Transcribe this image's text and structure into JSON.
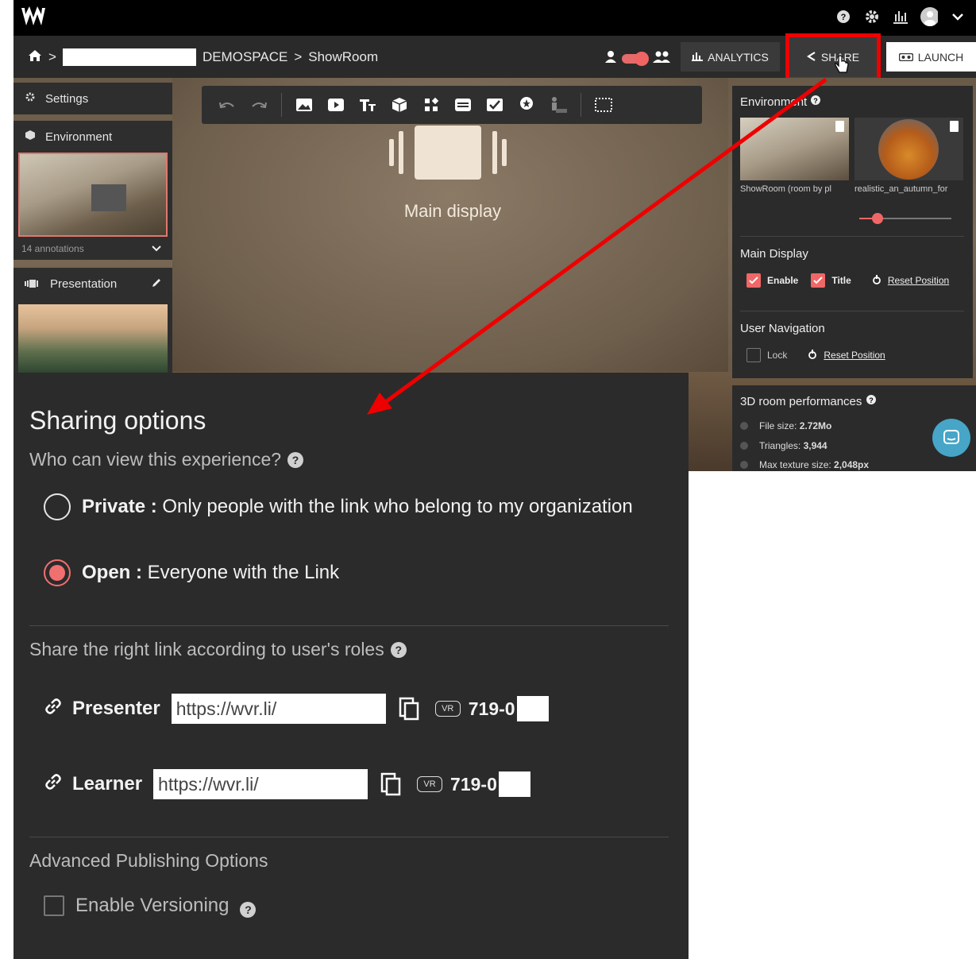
{
  "header": {
    "icons": [
      "help-icon",
      "gear-icon",
      "analytics-icon",
      "avatar",
      "chevron-down-icon"
    ]
  },
  "nav": {
    "breadcrumb": {
      "space": "DEMOSPACE",
      "separator": ">",
      "room": "ShowRoom"
    },
    "analytics_label": "ANALYTICS",
    "share_label": "SHARE",
    "launch_label": "LAUNCH"
  },
  "left_panel": {
    "settings_label": "Settings",
    "environment_label": "Environment",
    "annotations_label": "14 annotations",
    "presentation_label": "Presentation"
  },
  "canvas": {
    "display_label": "Main display"
  },
  "right_panel": {
    "environment_title": "Environment",
    "env_items": [
      {
        "caption": "ShowRoom (room by pl"
      },
      {
        "caption": "realistic_an_autumn_for"
      }
    ],
    "main_display_title": "Main Display",
    "enable_label": "Enable",
    "title_label": "Title",
    "reset_position_label": "Reset Position",
    "user_navigation_title": "User Navigation",
    "lock_label": "Lock"
  },
  "performance": {
    "title": "3D room performances",
    "rows": [
      {
        "label": "File size: ",
        "value": "2.72Mo"
      },
      {
        "label": "Triangles: ",
        "value": "3,944"
      },
      {
        "label": "Max texture size: ",
        "value": "2,048px"
      }
    ]
  },
  "sharing": {
    "title": "Sharing options",
    "who_label": "Who can view this experience?",
    "private_bold": "Private :",
    "private_text": " Only people with the link who belong to my organization",
    "open_bold": "Open :",
    "open_text": " Everyone with the Link",
    "selected": "open",
    "roles_label": "Share the right link according to user's roles",
    "presenter_label": "Presenter",
    "presenter_link": "https://wvr.li/",
    "presenter_code": "719-0",
    "learner_label": "Learner",
    "learner_link": "https://wvr.li/",
    "learner_code": "719-0",
    "vr_badge": "VR",
    "advanced_label": "Advanced Publishing Options",
    "versioning_label": "Enable Versioning"
  },
  "colors": {
    "accent": "#f07070",
    "highlight": "#ee0000",
    "panel": "#2b2b2b",
    "chat": "#47a5c8"
  }
}
